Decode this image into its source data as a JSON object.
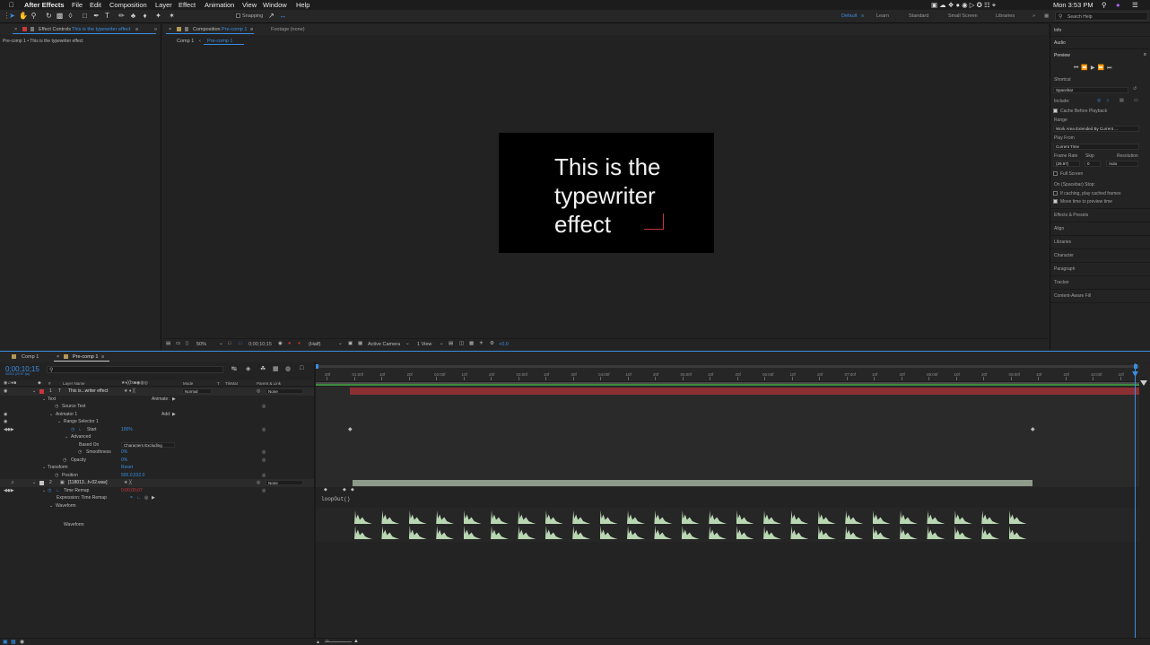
{
  "menubar": {
    "app": "After Effects",
    "items": [
      "File",
      "Edit",
      "Composition",
      "Layer",
      "Effect",
      "Animation",
      "View",
      "Window",
      "Help"
    ],
    "clock": "Mon 3:53 PM"
  },
  "toolbar": {
    "snapping": "Snapping",
    "workspaces": [
      "Default",
      "Learn",
      "Standard",
      "Small Screen",
      "Libraries"
    ],
    "search_placeholder": "Search Help"
  },
  "effect_controls": {
    "tab_prefix": "Effect Controls",
    "tab_layer": "This is the typewriter effect",
    "subtitle": "Pre-comp 1 • This is the typewriter effect"
  },
  "composition": {
    "tab_prefix": "Composition",
    "tab_name": "Pre-comp 1",
    "footage_tab": "Footage (none)",
    "nav": [
      "Comp 1",
      "Pre-comp 1"
    ],
    "text_lines": [
      "This is the",
      "typewriter",
      "effect"
    ],
    "zoom": "50%",
    "timecode": "0;00;10;15",
    "resolution": "(Half)",
    "camera": "Active Camera",
    "views": "1 View",
    "exposure": "+0.0"
  },
  "right_panel": {
    "items_top": [
      "Info",
      "Audio"
    ],
    "preview": {
      "title": "Preview",
      "shortcut_label": "Shortcut",
      "shortcut": "Spacebar",
      "include": "Include:",
      "cache": "Cache Before Playback",
      "range_label": "Range",
      "range": "Work Area Extended By Current ...",
      "play_from_label": "Play From",
      "play_from": "Current Time",
      "frame_rate_label": "Frame Rate",
      "skip_label": "Skip",
      "resolution_label": "Resolution",
      "frame_rate": "(29.97)",
      "skip": "0",
      "resolution": "Auto",
      "full_screen": "Full Screen",
      "stop_label": "On (Spacebar) Stop:",
      "if_caching": "If caching, play cached frames",
      "move_time": "Move time to preview time"
    },
    "items_bottom": [
      "Effects & Presets",
      "Align",
      "Libraries",
      "Character",
      "Paragraph",
      "Tracker",
      "Content-Aware Fill"
    ]
  },
  "timeline": {
    "tabs": [
      "Comp 1",
      "Pre-comp 1"
    ],
    "timecode": "0;00;10;15",
    "fps": "00315 (29.97 fps)",
    "col_layer_name": "Layer Name",
    "col_mode": "Mode",
    "col_t": "T",
    "col_trkmat": "TrkMat",
    "col_parent": "Parent & Link",
    "animate": "Animate:",
    "add": "Add:",
    "layers": [
      {
        "num": "1",
        "name": "This is...writer effect",
        "mode": "Normal",
        "parent": "None"
      },
      {
        "num": "2",
        "name": "[118013...h-02.wav]",
        "parent": "None"
      }
    ],
    "props": {
      "text": "Text",
      "source_text": "Source Text",
      "animator": "Animator 1",
      "range_selector": "Range Selector 1",
      "start": "Start",
      "start_val": "100%",
      "advanced": "Advanced",
      "based_on": "Based On",
      "based_on_val": "Characters Excluding",
      "smoothness": "Smoothness",
      "smoothness_val": "0%",
      "opacity": "Opacity",
      "opacity_val": "0%",
      "transform": "Transform",
      "reset": "Reset",
      "position": "Position",
      "position_val": "500.0,532.0",
      "time_remap": "Time Remap",
      "time_remap_val": "0;00;00;07",
      "expression": "Expression: Time Remap",
      "waveform": "Waveform",
      "waveform2": "Waveform",
      "loop": "loopOut()"
    },
    "ruler": [
      "20f",
      "01:00f",
      "10f",
      "20f",
      "02:00f",
      "10f",
      "20f",
      "03:00f",
      "10f",
      "20f",
      "04:00f",
      "10f",
      "20f",
      "05:00f",
      "10f",
      "20f",
      "06:00f",
      "10f",
      "20f",
      "07:00f",
      "10f",
      "20f",
      "08:00f",
      "10f",
      "20f",
      "09:00f",
      "10f",
      "20f",
      "10:00f",
      "10f"
    ]
  },
  "colors": {
    "accent": "#3a8de4",
    "label_red": "#c8373e",
    "bar_red": "#8c2f33",
    "bar_green": "#3d8b3d",
    "audio_bar": "#8e9a8a",
    "waveform": "#b9d6b3"
  }
}
